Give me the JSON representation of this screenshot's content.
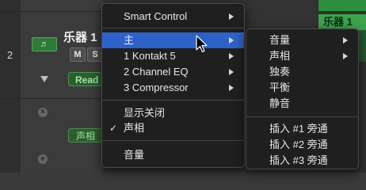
{
  "track": {
    "number": "2",
    "name": "乐器 1",
    "icon": "music-note-icon",
    "mute_label": "M",
    "solo_label": "S",
    "automation_mode": "Read",
    "pan_label": "声相"
  },
  "region": {
    "name": "乐器 1"
  },
  "context_menu": {
    "items": [
      {
        "label": "Smart Control",
        "submenu": true
      },
      {
        "label": "主",
        "submenu": true,
        "highlighted": true
      },
      {
        "label": "1 Kontakt 5",
        "submenu": true
      },
      {
        "label": "2 Channel EQ",
        "submenu": true
      },
      {
        "label": "3 Compressor",
        "submenu": true
      },
      {
        "label": "显示关闭"
      },
      {
        "label": "声相",
        "checked": true,
        "check_mark": "✓"
      },
      {
        "label": "音量"
      }
    ]
  },
  "sub_menu": {
    "items": [
      {
        "label": "音量",
        "submenu": true
      },
      {
        "label": "声相",
        "submenu": true
      },
      {
        "label": "独奏"
      },
      {
        "label": "平衡"
      },
      {
        "label": "静音"
      },
      {
        "label": "插入 #1 旁通"
      },
      {
        "label": "插入 #2 旁通"
      },
      {
        "label": "插入 #3 旁通"
      }
    ]
  },
  "colors": {
    "menu_highlight": "#2d62c9",
    "region_green": "#3da44e",
    "read_green": "#9fe3a0"
  }
}
